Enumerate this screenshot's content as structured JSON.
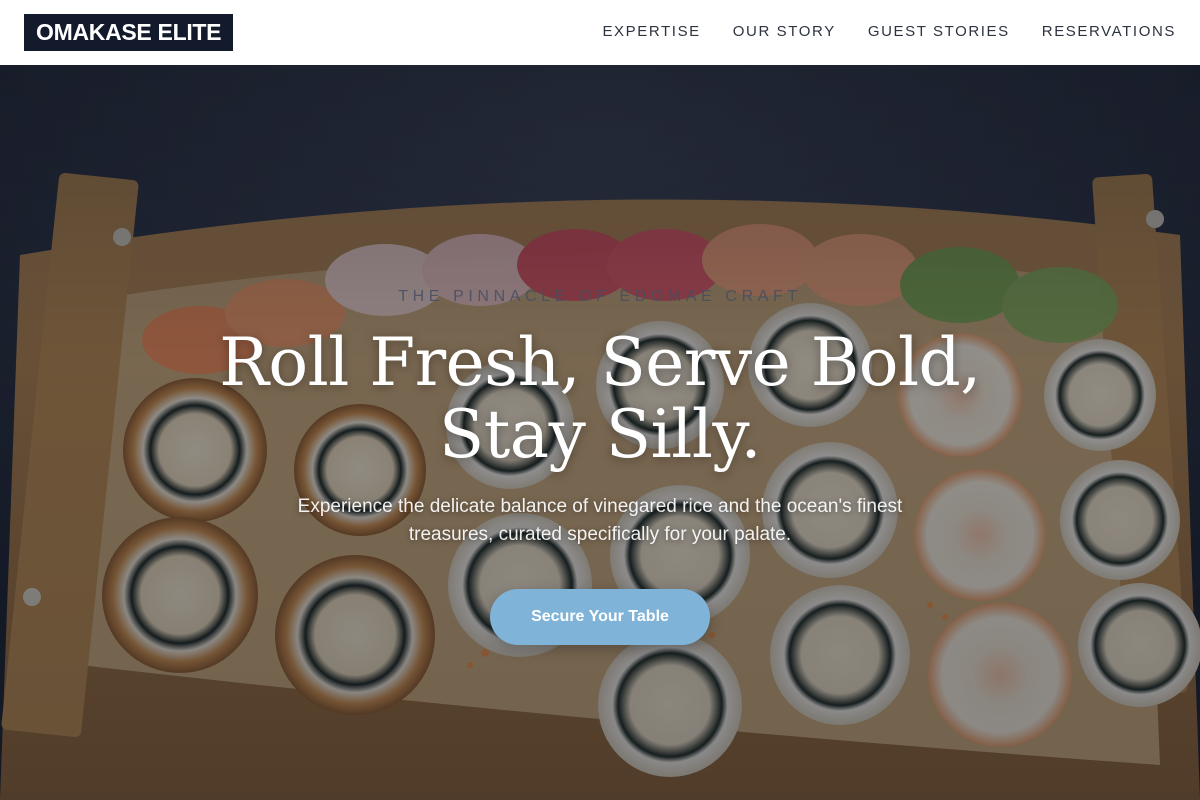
{
  "brand": {
    "logo_text": "OMAKASE ELITE"
  },
  "nav": {
    "items": [
      {
        "label": "EXPERTISE"
      },
      {
        "label": "OUR STORY"
      },
      {
        "label": "GUEST STORIES"
      },
      {
        "label": "RESERVATIONS"
      }
    ]
  },
  "hero": {
    "eyebrow": "THE PINNACLE OF EDOMAE CRAFT",
    "headline_line1": "Roll Fresh, Serve Bold,",
    "headline_line2": "Stay Silly.",
    "subtext": "Experience the delicate balance of vinegared rice and the ocean's finest treasures, curated specifically for your palate.",
    "cta_label": "Secure Your Table",
    "background_image": "sushi-boat-photo"
  },
  "colors": {
    "logo_bg": "#121a2c",
    "cta_bg": "#7fb3d8",
    "nav_text": "#2d3340"
  }
}
